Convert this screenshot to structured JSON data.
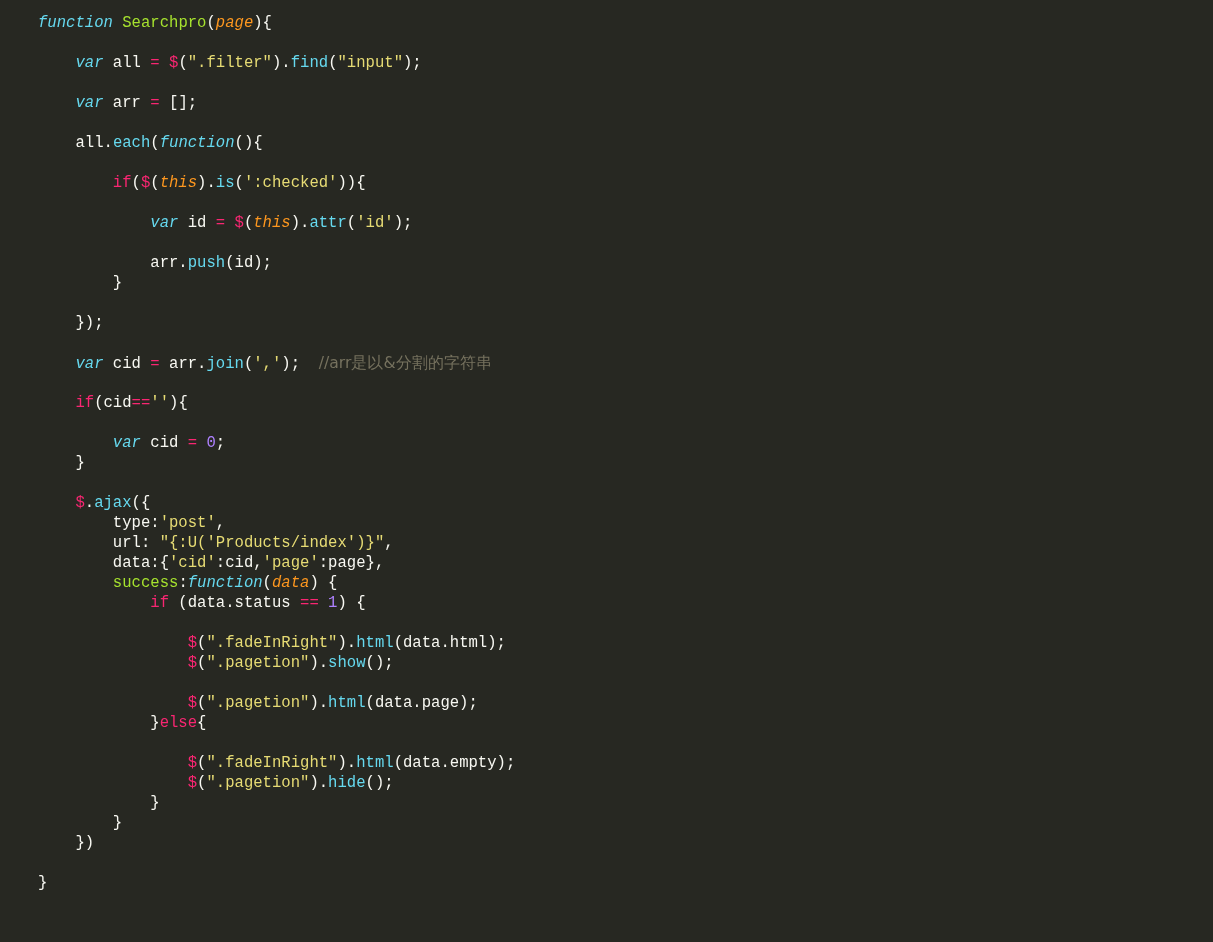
{
  "editor": {
    "lines": [
      {
        "kind": "code",
        "tokens": [
          {
            "kind": "keyword",
            "text": "function "
          },
          {
            "kind": "name",
            "text": "Searchpro"
          },
          {
            "kind": "plain",
            "text": "("
          },
          {
            "kind": "param",
            "text": "page"
          },
          {
            "kind": "plain",
            "text": "){"
          }
        ]
      },
      {
        "kind": "blank"
      },
      {
        "kind": "code",
        "tokens": [
          {
            "kind": "keyword",
            "text": "    var"
          },
          {
            "kind": "plain",
            "text": " all "
          },
          {
            "kind": "operator",
            "text": "="
          },
          {
            "kind": "operator",
            "text": " $"
          },
          {
            "kind": "plain",
            "text": "("
          },
          {
            "kind": "string",
            "text": "\".filter\""
          },
          {
            "kind": "plain",
            "text": ")."
          },
          {
            "kind": "method",
            "text": "find"
          },
          {
            "kind": "plain",
            "text": "("
          },
          {
            "kind": "string",
            "text": "\"input\""
          },
          {
            "kind": "plain",
            "text": ");"
          }
        ]
      },
      {
        "kind": "blank"
      },
      {
        "kind": "code",
        "tokens": [
          {
            "kind": "keyword",
            "text": "    var"
          },
          {
            "kind": "plain",
            "text": " arr "
          },
          {
            "kind": "operator",
            "text": "="
          },
          {
            "kind": "plain",
            "text": " [];"
          }
        ]
      },
      {
        "kind": "blank"
      },
      {
        "kind": "code",
        "tokens": [
          {
            "kind": "plain",
            "text": "    all."
          },
          {
            "kind": "method",
            "text": "each"
          },
          {
            "kind": "plain",
            "text": "("
          },
          {
            "kind": "keyword",
            "text": "function"
          },
          {
            "kind": "plain",
            "text": "(){"
          }
        ]
      },
      {
        "kind": "blank"
      },
      {
        "kind": "code",
        "tokens": [
          {
            "kind": "operator",
            "text": "        if"
          },
          {
            "kind": "plain",
            "text": "("
          },
          {
            "kind": "operator",
            "text": "$"
          },
          {
            "kind": "plain",
            "text": "("
          },
          {
            "kind": "param",
            "text": "this"
          },
          {
            "kind": "plain",
            "text": ")."
          },
          {
            "kind": "method",
            "text": "is"
          },
          {
            "kind": "plain",
            "text": "("
          },
          {
            "kind": "string",
            "text": "':checked'"
          },
          {
            "kind": "plain",
            "text": ")){"
          }
        ]
      },
      {
        "kind": "blank"
      },
      {
        "kind": "code",
        "tokens": [
          {
            "kind": "keyword",
            "text": "            var"
          },
          {
            "kind": "plain",
            "text": " id "
          },
          {
            "kind": "operator",
            "text": "="
          },
          {
            "kind": "operator",
            "text": " $"
          },
          {
            "kind": "plain",
            "text": "("
          },
          {
            "kind": "param",
            "text": "this"
          },
          {
            "kind": "plain",
            "text": ")."
          },
          {
            "kind": "method",
            "text": "attr"
          },
          {
            "kind": "plain",
            "text": "("
          },
          {
            "kind": "string",
            "text": "'id'"
          },
          {
            "kind": "plain",
            "text": ");"
          }
        ]
      },
      {
        "kind": "blank"
      },
      {
        "kind": "code",
        "tokens": [
          {
            "kind": "plain",
            "text": "            arr."
          },
          {
            "kind": "method",
            "text": "push"
          },
          {
            "kind": "plain",
            "text": "(id);"
          }
        ]
      },
      {
        "kind": "code",
        "tokens": [
          {
            "kind": "plain",
            "text": "        }"
          }
        ]
      },
      {
        "kind": "blank"
      },
      {
        "kind": "code",
        "tokens": [
          {
            "kind": "plain",
            "text": "    });"
          }
        ]
      },
      {
        "kind": "blank"
      },
      {
        "kind": "code",
        "tokens": [
          {
            "kind": "keyword",
            "text": "    var"
          },
          {
            "kind": "plain",
            "text": " cid "
          },
          {
            "kind": "operator",
            "text": "="
          },
          {
            "kind": "plain",
            "text": " arr."
          },
          {
            "kind": "method",
            "text": "join"
          },
          {
            "kind": "plain",
            "text": "("
          },
          {
            "kind": "string",
            "text": "','"
          },
          {
            "kind": "plain",
            "text": ");  "
          },
          {
            "kind": "comment",
            "text": "//arr是以&分割的字符串"
          }
        ]
      },
      {
        "kind": "blank"
      },
      {
        "kind": "code",
        "tokens": [
          {
            "kind": "operator",
            "text": "    if"
          },
          {
            "kind": "plain",
            "text": "(cid"
          },
          {
            "kind": "operator",
            "text": "=="
          },
          {
            "kind": "string",
            "text": "''"
          },
          {
            "kind": "plain",
            "text": "){"
          }
        ]
      },
      {
        "kind": "blank"
      },
      {
        "kind": "code",
        "tokens": [
          {
            "kind": "keyword",
            "text": "        var"
          },
          {
            "kind": "plain",
            "text": " cid "
          },
          {
            "kind": "operator",
            "text": "="
          },
          {
            "kind": "number",
            "text": " 0"
          },
          {
            "kind": "plain",
            "text": ";"
          }
        ]
      },
      {
        "kind": "code",
        "tokens": [
          {
            "kind": "plain",
            "text": "    }"
          }
        ]
      },
      {
        "kind": "blank"
      },
      {
        "kind": "code",
        "tokens": [
          {
            "kind": "operator",
            "text": "    $"
          },
          {
            "kind": "plain",
            "text": "."
          },
          {
            "kind": "method",
            "text": "ajax"
          },
          {
            "kind": "plain",
            "text": "({"
          }
        ]
      },
      {
        "kind": "code",
        "tokens": [
          {
            "kind": "plain",
            "text": "        type:"
          },
          {
            "kind": "string",
            "text": "'post'"
          },
          {
            "kind": "plain",
            "text": ","
          }
        ]
      },
      {
        "kind": "code",
        "tokens": [
          {
            "kind": "plain",
            "text": "        url: "
          },
          {
            "kind": "string",
            "text": "\"{:U('Products/index')}\""
          },
          {
            "kind": "plain",
            "text": ","
          }
        ]
      },
      {
        "kind": "code",
        "tokens": [
          {
            "kind": "plain",
            "text": "        data:{"
          },
          {
            "kind": "string",
            "text": "'cid'"
          },
          {
            "kind": "plain",
            "text": ":cid,"
          },
          {
            "kind": "string",
            "text": "'page'"
          },
          {
            "kind": "plain",
            "text": ":page},"
          }
        ]
      },
      {
        "kind": "code",
        "tokens": [
          {
            "kind": "name",
            "text": "        success"
          },
          {
            "kind": "plain",
            "text": ":"
          },
          {
            "kind": "keyword",
            "text": "function"
          },
          {
            "kind": "plain",
            "text": "("
          },
          {
            "kind": "param",
            "text": "data"
          },
          {
            "kind": "plain",
            "text": ") {"
          }
        ]
      },
      {
        "kind": "code",
        "tokens": [
          {
            "kind": "operator",
            "text": "            if"
          },
          {
            "kind": "plain",
            "text": " (data.status "
          },
          {
            "kind": "operator",
            "text": "=="
          },
          {
            "kind": "number",
            "text": " 1"
          },
          {
            "kind": "plain",
            "text": ") {"
          }
        ]
      },
      {
        "kind": "blank"
      },
      {
        "kind": "code",
        "tokens": [
          {
            "kind": "operator",
            "text": "                $"
          },
          {
            "kind": "plain",
            "text": "("
          },
          {
            "kind": "string",
            "text": "\".fadeInRight\""
          },
          {
            "kind": "plain",
            "text": ")."
          },
          {
            "kind": "method",
            "text": "html"
          },
          {
            "kind": "plain",
            "text": "(data.html);"
          }
        ]
      },
      {
        "kind": "code",
        "tokens": [
          {
            "kind": "operator",
            "text": "                $"
          },
          {
            "kind": "plain",
            "text": "("
          },
          {
            "kind": "string",
            "text": "\".pagetion\""
          },
          {
            "kind": "plain",
            "text": ")."
          },
          {
            "kind": "method",
            "text": "show"
          },
          {
            "kind": "plain",
            "text": "();"
          }
        ]
      },
      {
        "kind": "blank"
      },
      {
        "kind": "code",
        "tokens": [
          {
            "kind": "operator",
            "text": "                $"
          },
          {
            "kind": "plain",
            "text": "("
          },
          {
            "kind": "string",
            "text": "\".pagetion\""
          },
          {
            "kind": "plain",
            "text": ")."
          },
          {
            "kind": "method",
            "text": "html"
          },
          {
            "kind": "plain",
            "text": "(data.page);"
          }
        ]
      },
      {
        "kind": "code",
        "tokens": [
          {
            "kind": "plain",
            "text": "            }"
          },
          {
            "kind": "operator",
            "text": "else"
          },
          {
            "kind": "plain",
            "text": "{"
          }
        ]
      },
      {
        "kind": "blank"
      },
      {
        "kind": "code",
        "tokens": [
          {
            "kind": "operator",
            "text": "                $"
          },
          {
            "kind": "plain",
            "text": "("
          },
          {
            "kind": "string",
            "text": "\".fadeInRight\""
          },
          {
            "kind": "plain",
            "text": ")."
          },
          {
            "kind": "method",
            "text": "html"
          },
          {
            "kind": "plain",
            "text": "(data.empty);"
          }
        ]
      },
      {
        "kind": "code",
        "tokens": [
          {
            "kind": "operator",
            "text": "                $"
          },
          {
            "kind": "plain",
            "text": "("
          },
          {
            "kind": "string",
            "text": "\".pagetion\""
          },
          {
            "kind": "plain",
            "text": ")."
          },
          {
            "kind": "method",
            "text": "hide"
          },
          {
            "kind": "plain",
            "text": "();"
          }
        ]
      },
      {
        "kind": "code",
        "tokens": [
          {
            "kind": "plain",
            "text": "            }"
          }
        ]
      },
      {
        "kind": "code",
        "tokens": [
          {
            "kind": "plain",
            "text": "        }"
          }
        ]
      },
      {
        "kind": "code",
        "tokens": [
          {
            "kind": "plain",
            "text": "    })"
          }
        ]
      },
      {
        "kind": "blank"
      },
      {
        "kind": "code",
        "tokens": [
          {
            "kind": "plain",
            "text": "}"
          }
        ]
      }
    ]
  }
}
